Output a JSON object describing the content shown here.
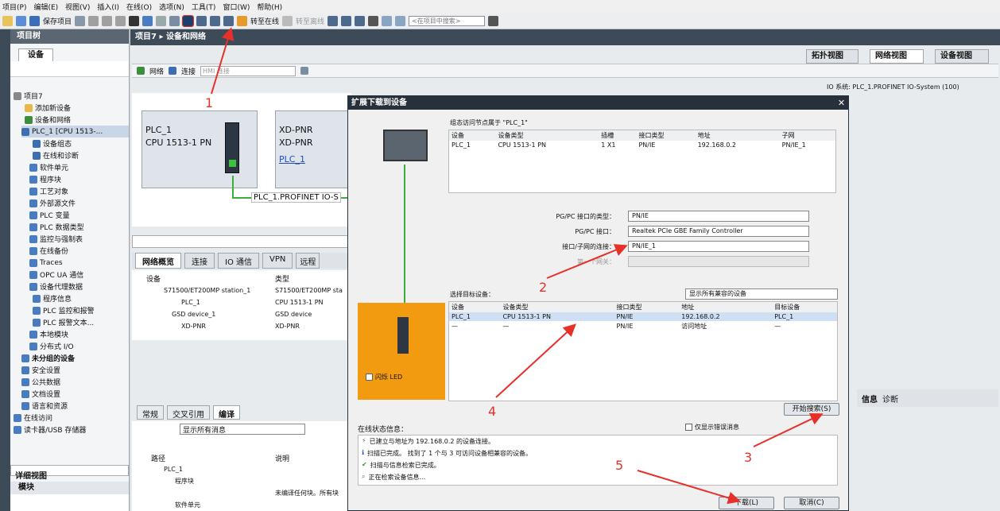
{
  "menu": [
    "项目(P)",
    "编辑(E)",
    "视图(V)",
    "插入(I)",
    "在线(O)",
    "选项(N)",
    "工具(T)",
    "窗口(W)",
    "帮助(H)"
  ],
  "toolbar": {
    "save_label": "保存项目",
    "go_online": "转至在线",
    "go_offline": "转至离线",
    "search_placeholder": "<在项目中搜索>"
  },
  "project_tree": {
    "title": "项目树",
    "tab": "设备",
    "items": [
      "项目7",
      "添加新设备",
      "设备和网络",
      "PLC_1 [CPU 1513-...",
      "设备组态",
      "在线和诊断",
      "软件单元",
      "程序块",
      "工艺对象",
      "外部源文件",
      "PLC 变量",
      "PLC 数据类型",
      "监控与强制表",
      "在线备份",
      "Traces",
      "OPC UA 通信",
      "设备代理数据",
      "程序信息",
      "PLC 监控和报警",
      "PLC 报警文本...",
      "本地模块",
      "分布式 I/O",
      "未分组的设备",
      "安全设置",
      "公共数据",
      "文档设置",
      "语言和资源",
      "在线访问",
      "读卡器/USB 存储器"
    ],
    "detail_view": "详细视图",
    "module": "模块"
  },
  "main": {
    "breadcrumb": "项目7 ▸ 设备和网络",
    "tabs": [
      "拓扑视图",
      "网络视图",
      "设备视图"
    ],
    "net_toolbar": {
      "network": "网络",
      "connect": "连接",
      "hmi": "HMI 连接"
    },
    "io_system": "IO 系统: PLC_1.PROFINET IO-System (100)",
    "plc_name": "PLC_1",
    "plc_cpu": "CPU 1513-1 PN",
    "xd_name": "XD-PNR",
    "xd_sub": "XD-PNR",
    "xd_link": "PLC_1",
    "profinet_label": "PLC_1.PROFINET IO-S",
    "overview_tabs": [
      "网络概览",
      "连接",
      "IO 通信",
      "VPN",
      "远程"
    ],
    "overview_headers": [
      "设备",
      "类型"
    ],
    "overview_rows": [
      [
        "S71500/ET200MP station_1",
        "S71500/ET200MP sta"
      ],
      [
        "PLC_1",
        "CPU 1513-1 PN"
      ],
      [
        "GSD device_1",
        "GSD device"
      ],
      [
        "XD-PNR",
        "XD-PNR"
      ]
    ],
    "props_tabs": [
      "常规",
      "交叉引用",
      "编译"
    ],
    "props_filter": "显示所有消息",
    "props_headers": [
      "路径",
      "说明"
    ],
    "props_rows": [
      [
        "PLC_1",
        ""
      ],
      [
        "程序块",
        ""
      ],
      [
        "",
        "未编译任何块。所有块"
      ],
      [
        "软件单元",
        ""
      ]
    ],
    "info_tabs": [
      "信息",
      "诊断"
    ]
  },
  "dialog": {
    "title": "扩展下载到设备",
    "node_label": "组态访问节点属于 \"PLC_1\"",
    "top_headers": [
      "设备",
      "设备类型",
      "插槽",
      "接口类型",
      "地址",
      "子网"
    ],
    "top_row": [
      "PLC_1",
      "CPU 1513-1 PN",
      "1 X1",
      "PN/IE",
      "192.168.0.2",
      "PN/IE_1"
    ],
    "pgpc_type_label": "PG/PC 接口的类型：",
    "pgpc_type": "PN/IE",
    "pgpc_iface_label": "PG/PC 接口：",
    "pgpc_iface": "Realtek PCIe GBE Family Controller",
    "subnet_label": "接口/子网的连接：",
    "subnet": "PN/IE_1",
    "gateway_label": "第一个网关：",
    "target_label": "选择目标设备：",
    "target_filter": "显示所有兼容的设备",
    "target_headers": [
      "设备",
      "设备类型",
      "接口类型",
      "地址",
      "目标设备"
    ],
    "target_rows": [
      [
        "PLC_1",
        "CPU 1513-1 PN",
        "PN/IE",
        "192.168.0.2",
        "PLC_1"
      ],
      [
        "—",
        "—",
        "PN/IE",
        "访问地址",
        "—"
      ]
    ],
    "flash_led": "闪烁 LED",
    "search_button": "开始搜索(S)",
    "status_label": "在线状态信息：",
    "only_errors": "仅显示错误消息",
    "status_lines": [
      "已建立与地址为 192.168.0.2 的设备连接。",
      "扫描已完成。 找到了 1 个与 3 可访问设备相兼容的设备。",
      "扫描与信息检索已完成。",
      "正在检索设备信息..."
    ],
    "download_button": "下载(L)",
    "cancel_button": "取消(C)"
  },
  "annotations": [
    "1",
    "2",
    "3",
    "4",
    "5"
  ],
  "colors": {
    "accent": "#e8302a",
    "header": "#27313b",
    "orange": "#f39b10"
  }
}
